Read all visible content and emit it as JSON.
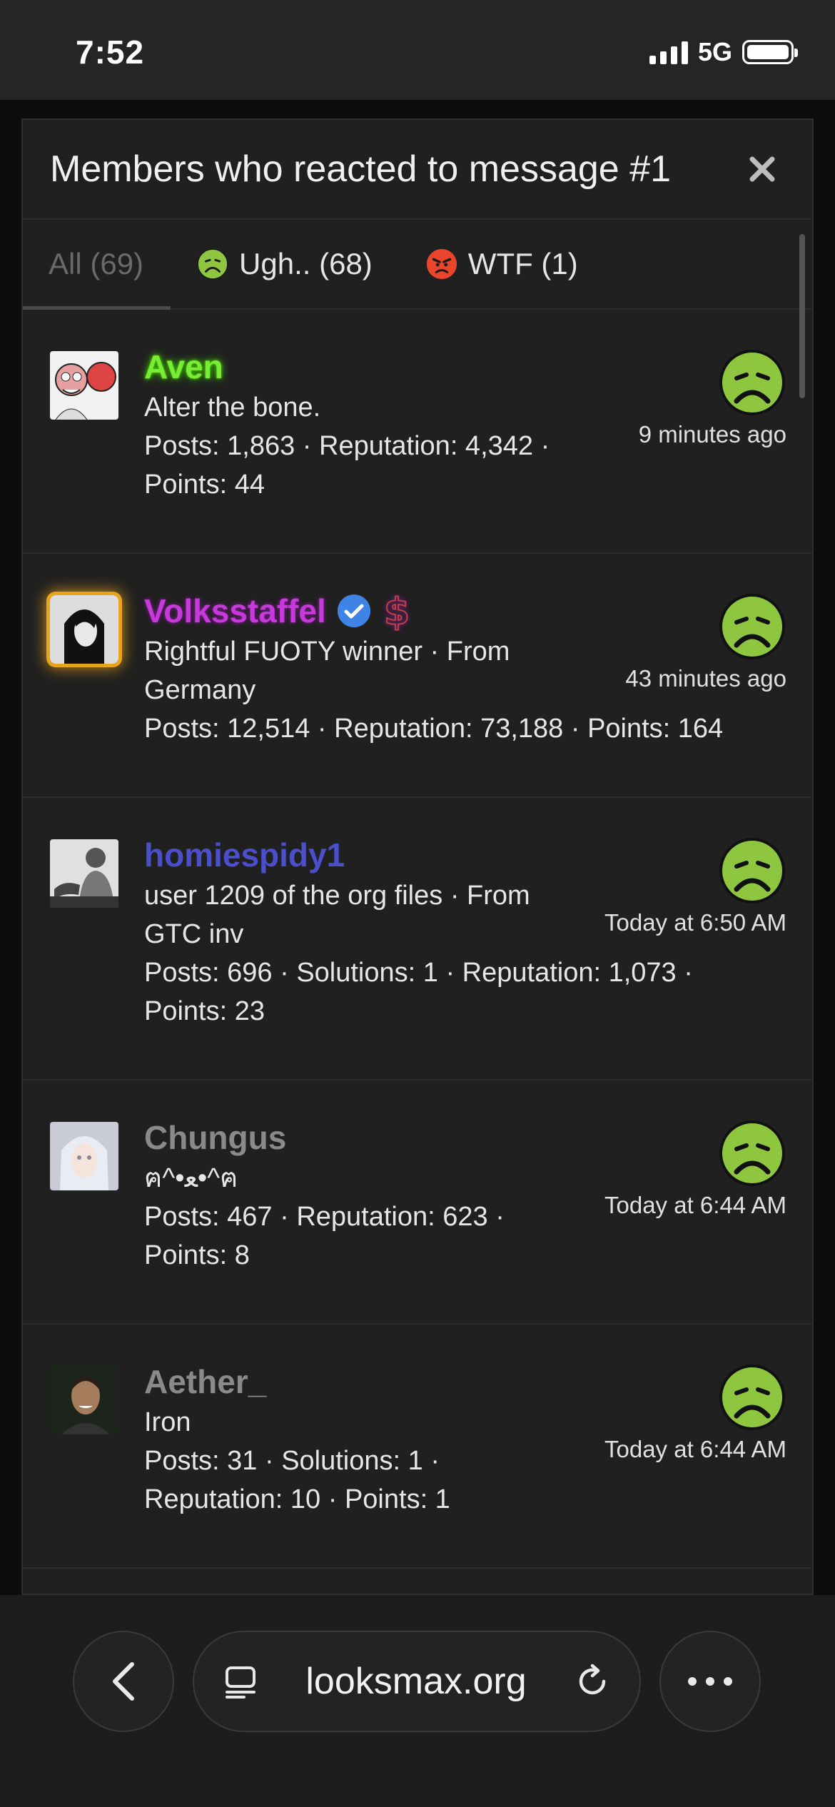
{
  "status_bar": {
    "time": "7:52",
    "network": "5G"
  },
  "modal": {
    "title": "Members who reacted to message #1",
    "tabs": [
      {
        "label": "All (69)",
        "active": true,
        "emoji": ""
      },
      {
        "label": "Ugh.. (68)",
        "active": false,
        "emoji": "nauseated-face-icon"
      },
      {
        "label": "WTF (1)",
        "active": false,
        "emoji": "angry-face-icon"
      }
    ],
    "members": [
      {
        "username": "Aven",
        "user_title": "Alter the bone.",
        "stats_1": "Posts: 1,863 · Reputation: 4,342 ·",
        "stats_2": "Points: 44",
        "time": "9 minutes ago",
        "name_color": "#7aec38"
      },
      {
        "username": "Volksstaffel",
        "user_title_1": "Rightful FUOTY winner · From",
        "user_title_2": "Germany",
        "stats_1": "Posts: 12,514 · Reputation: 73,188 · Points: 164",
        "time": "43 minutes ago",
        "name_color": "#c53ad9",
        "badges": [
          "verified-icon",
          "dollar-icon"
        ]
      },
      {
        "username": "homiespidy1",
        "user_title_1": "user 1209 of the org files · From",
        "user_title_2": "GTC inv",
        "stats_1": "Posts: 696 · Solutions: 1 · Reputation: 1,073 ·",
        "stats_2": "Points: 23",
        "time": "Today at 6:50 AM",
        "name_color": "#4b4fc9"
      },
      {
        "username": "Chungus",
        "user_title": "ฅ^•ﻌ•^ฅ",
        "stats_1": "Posts: 467 · Reputation: 623 ·",
        "stats_2": "Points: 8",
        "time": "Today at 6:44 AM",
        "name_color": "#8a8a8a"
      },
      {
        "username": "Aether_",
        "user_title": "Iron",
        "stats_1": "Posts: 31 · Solutions: 1 ·",
        "stats_2": "Reputation: 10 · Points: 1",
        "time": "Today at 6:44 AM",
        "name_color": "#8a8a8a"
      }
    ]
  },
  "browser": {
    "url": "looksmax.org"
  },
  "colors": {
    "reaction_green": "#8ec63f",
    "wtf_red": "#e8452c",
    "background": "#202020"
  }
}
